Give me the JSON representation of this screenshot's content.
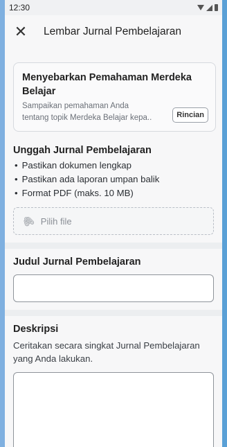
{
  "status": {
    "time": "12:30",
    "icons": [
      "wifi-icon",
      "signal-icon",
      "battery-icon"
    ]
  },
  "header": {
    "close_icon": "close-icon",
    "title": "Lembar Jurnal Pembelajaran"
  },
  "topic_card": {
    "title": "Menyebarkan Pemahaman Merdeka Belajar",
    "description": "Sampaikan pemahaman Anda tentang topik Merdeka Belajar kepa..",
    "button_label": "Rincian"
  },
  "upload": {
    "title": "Unggah Jurnal Pembelajaran",
    "bullets": [
      "Pastikan dokumen lengkap",
      "Pastikan ada laporan umpan balik",
      "Format PDF (maks. 10 MB)"
    ],
    "file_placeholder": "Pilih file",
    "file_icon": "paperclip-icon"
  },
  "journal_title": {
    "label": "Judul Jurnal Pembelajaran",
    "value": ""
  },
  "description": {
    "label": "Deskripsi",
    "helper": "Ceritakan secara singkat Jurnal Pembelajaran yang Anda lakukan.",
    "value": ""
  },
  "colors": {
    "background": "#f7f7f8",
    "border": "#8e939a",
    "frame": "#7fb0e0"
  }
}
